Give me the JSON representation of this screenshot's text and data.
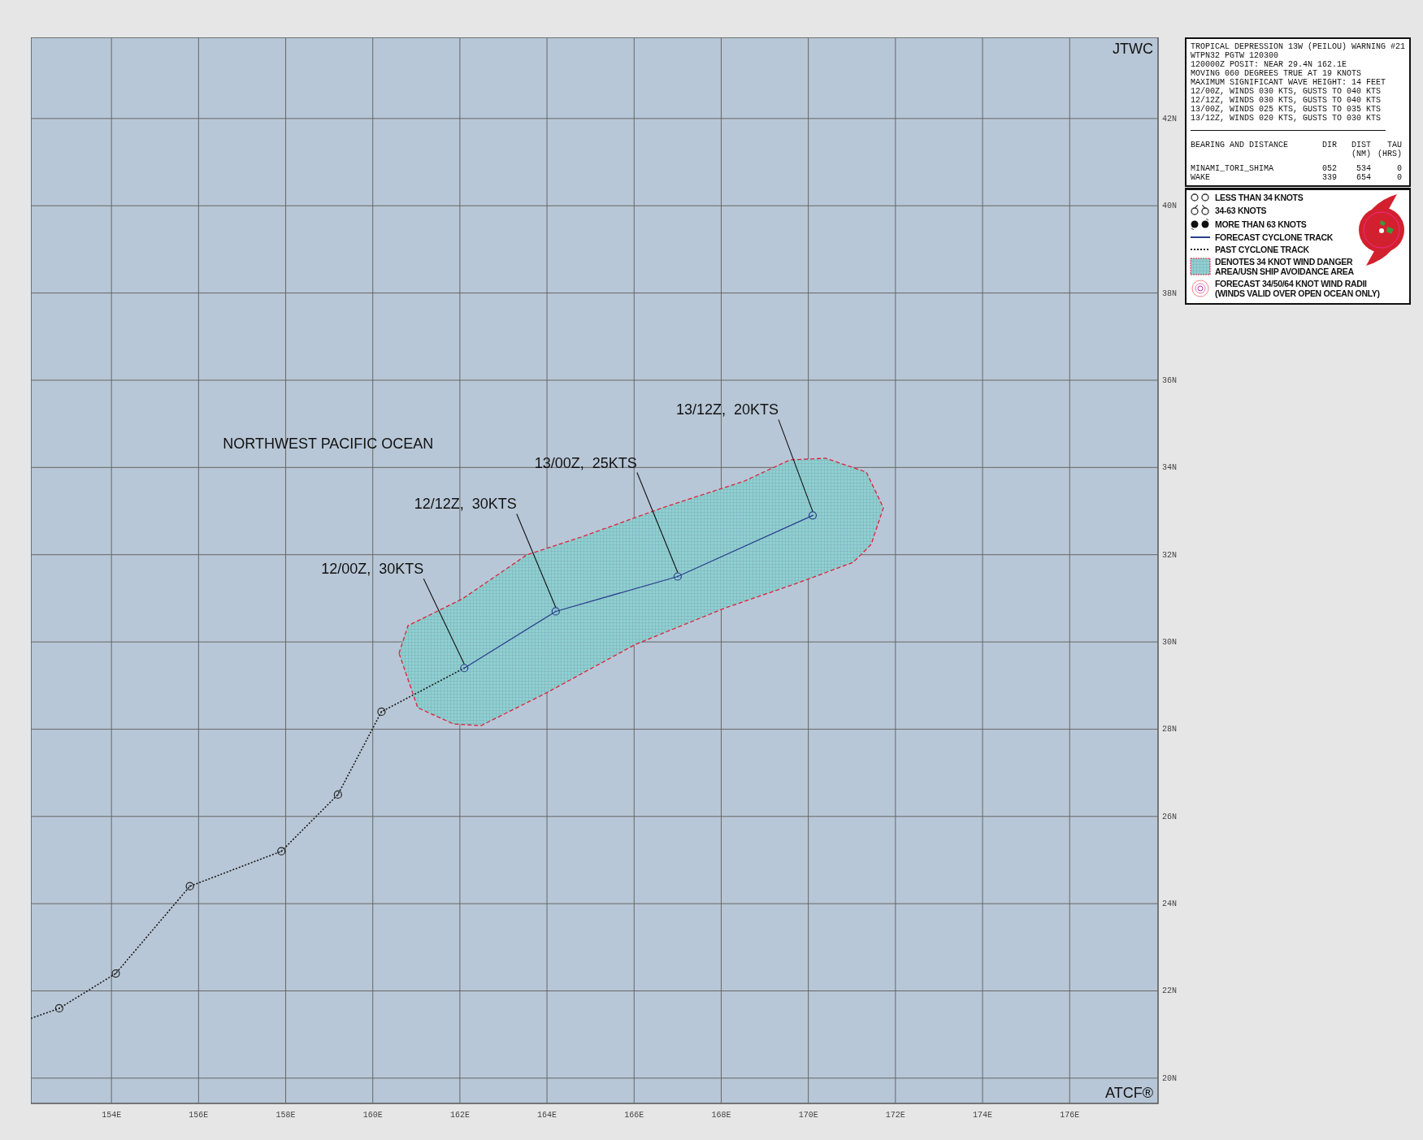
{
  "map": {
    "top_right_label": "JTWC",
    "bottom_right_label": "ATCF®",
    "region_label": "NORTHWEST PACIFIC OCEAN",
    "forecast_labels": [
      "12/00Z,  30KTS",
      "12/12Z,  30KTS",
      "13/00Z,  25KTS",
      "13/12Z,  20KTS"
    ],
    "chart_data": {
      "type": "line",
      "grid": true,
      "xlim": [
        152.15,
        178.03
      ],
      "ylim": [
        19.42,
        43.86
      ],
      "xticks": [
        {
          "value": 154,
          "label": "154E"
        },
        {
          "value": 156,
          "label": "156E"
        },
        {
          "value": 158,
          "label": "158E"
        },
        {
          "value": 160,
          "label": "160E"
        },
        {
          "value": 162,
          "label": "162E"
        },
        {
          "value": 164,
          "label": "164E"
        },
        {
          "value": 166,
          "label": "166E"
        },
        {
          "value": 168,
          "label": "168E"
        },
        {
          "value": 170,
          "label": "170E"
        },
        {
          "value": 172,
          "label": "172E"
        },
        {
          "value": 174,
          "label": "174E"
        },
        {
          "value": 176,
          "label": "176E"
        }
      ],
      "yticks": [
        {
          "value": 20,
          "label": "20N"
        },
        {
          "value": 22,
          "label": "22N"
        },
        {
          "value": 24,
          "label": "24N"
        },
        {
          "value": 26,
          "label": "26N"
        },
        {
          "value": 28,
          "label": "28N"
        },
        {
          "value": 30,
          "label": "30N"
        },
        {
          "value": 32,
          "label": "32N"
        },
        {
          "value": 34,
          "label": "34N"
        },
        {
          "value": 36,
          "label": "36N"
        },
        {
          "value": 38,
          "label": "38N"
        },
        {
          "value": 40,
          "label": "40N"
        },
        {
          "value": 42,
          "label": "42N"
        }
      ],
      "series": [
        {
          "color": "#1a1a1a",
          "line_style": "dotted",
          "marker": "circle",
          "x": [
            152.15,
            152.8,
            154.1,
            155.8,
            157.9,
            159.2,
            160.2,
            162.1
          ],
          "values": [
            21.37,
            21.6,
            22.4,
            24.4,
            25.2,
            26.5,
            28.4,
            29.4
          ]
        },
        {
          "color": "#2b3f8c",
          "line_style": "solid",
          "marker": "circle",
          "x": [
            162.1,
            164.2,
            167.0,
            170.1
          ],
          "values": [
            29.4,
            30.7,
            31.5,
            32.9
          ]
        }
      ]
    }
  },
  "warning": {
    "lines": [
      "TROPICAL DEPRESSION 13W (PEILOU) WARNING #21",
      "WTPN32 PGTW 120300",
      "120000Z POSIT: NEAR 29.4N 162.1E",
      "MOVING 060 DEGREES TRUE AT 19 KNOTS",
      "MAXIMUM SIGNIFICANT WAVE HEIGHT: 14 FEET",
      "12/00Z, WINDS 030 KTS, GUSTS TO 040 KTS",
      "12/12Z, WINDS 030 KTS, GUSTS TO 040 KTS",
      "13/00Z, WINDS 025 KTS, GUSTS TO 035 KTS",
      "13/12Z, WINDS 020 KTS, GUSTS TO 030 KTS"
    ],
    "table": {
      "columns": [
        {
          "label": "BEARING AND DISTANCE"
        },
        {
          "label": "DIR"
        },
        {
          "label": "DIST",
          "unit": "(NM)"
        },
        {
          "label": "TAU",
          "unit": "(HRS)"
        }
      ],
      "rows": [
        [
          "MINAMI_TORI_SHIMA",
          "052",
          "534",
          "0"
        ],
        [
          "WAKE",
          "339",
          "654",
          "0"
        ]
      ]
    }
  },
  "legend": [
    {
      "kind": "weak",
      "lines": [
        "LESS THAN 34 KNOTS"
      ]
    },
    {
      "kind": "medium",
      "lines": [
        "34-63 KNOTS"
      ]
    },
    {
      "kind": "strong",
      "lines": [
        "MORE THAN 63 KNOTS"
      ]
    },
    {
      "kind": "forecast_line",
      "lines": [
        "FORECAST CYCLONE TRACK"
      ]
    },
    {
      "kind": "past_line",
      "lines": [
        "PAST CYCLONE TRACK"
      ]
    },
    {
      "kind": "danger_area",
      "lines": [
        "DENOTES 34 KNOT WIND DANGER",
        "AREA/USN SHIP AVOIDANCE AREA"
      ]
    },
    {
      "kind": "wind_radii",
      "lines": [
        "FORECAST 34/50/64 KNOT WIND RADII",
        "(WINDS VALID OVER OPEN OCEAN ONLY)"
      ]
    }
  ]
}
